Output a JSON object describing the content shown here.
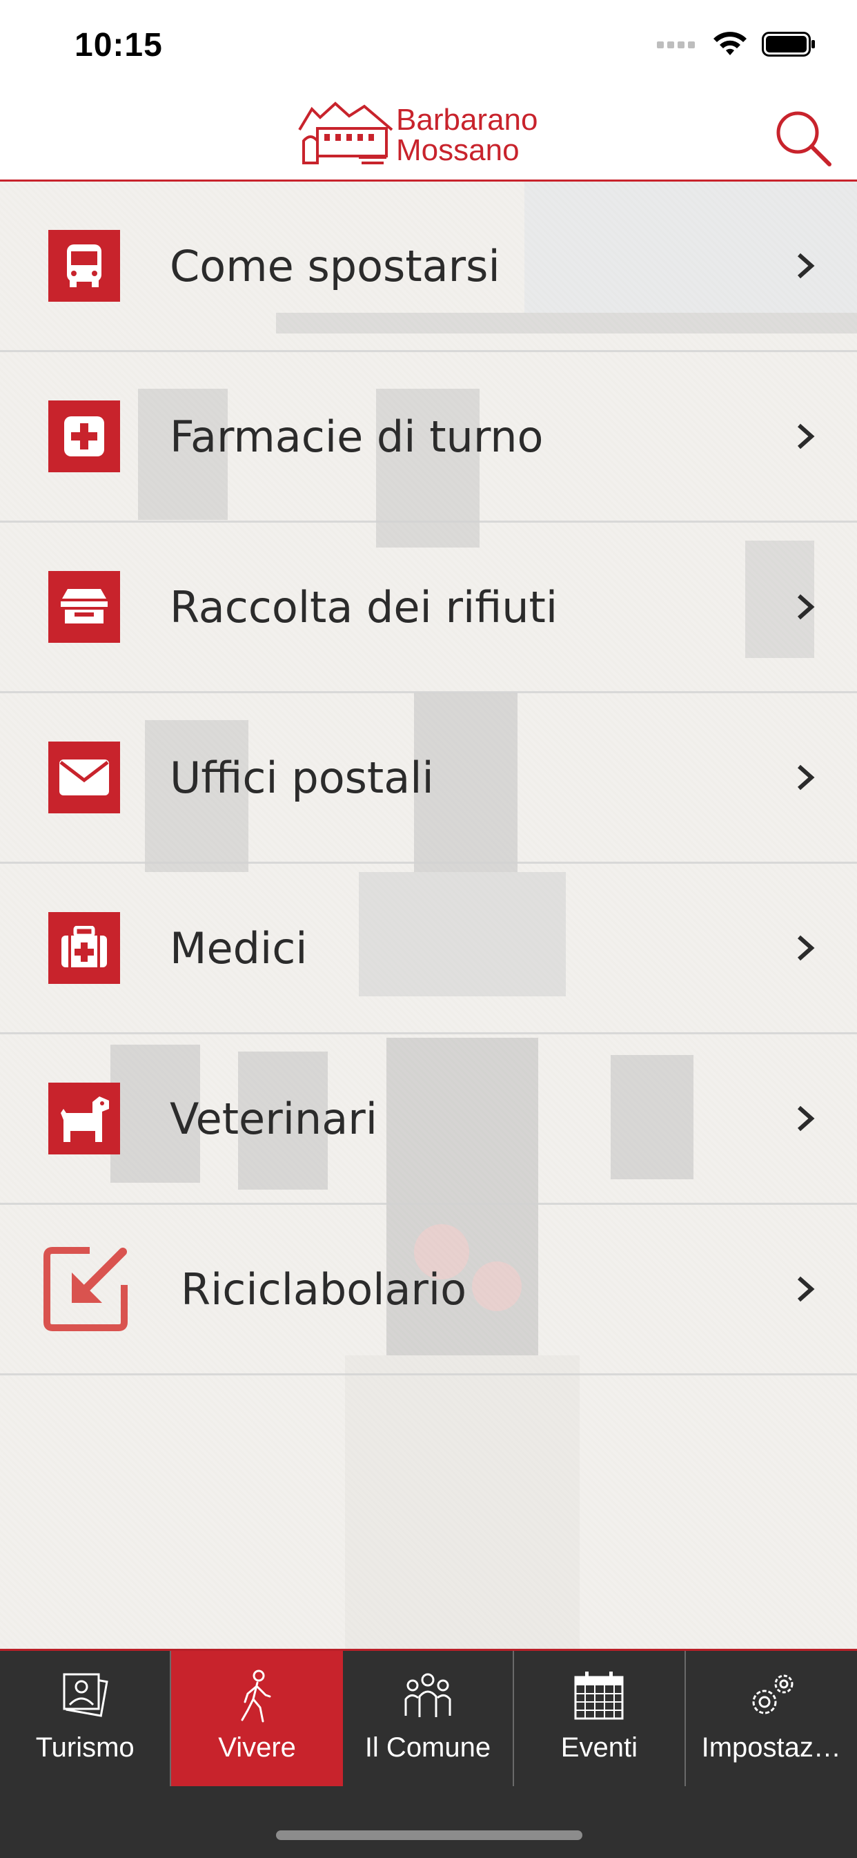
{
  "status_bar": {
    "time": "10:15"
  },
  "header": {
    "logo_line1": "Barbarano",
    "logo_line2": "Mossano",
    "search_icon": "search-icon"
  },
  "colors": {
    "accent": "#c8232c",
    "tabbar": "#303030",
    "text": "#2b2b2b"
  },
  "menu": {
    "items": [
      {
        "label": "Come spostarsi",
        "icon": "bus-icon"
      },
      {
        "label": "Farmacie di turno",
        "icon": "pharmacy-cross-icon"
      },
      {
        "label": "Raccolta dei rifiuti",
        "icon": "waste-bin-icon"
      },
      {
        "label": "Uffici postali",
        "icon": "envelope-icon"
      },
      {
        "label": "Medici",
        "icon": "medical-kit-icon"
      },
      {
        "label": "Veterinari",
        "icon": "dog-icon"
      },
      {
        "label": "Riciclabolario",
        "icon": "external-link-arrow-icon"
      }
    ]
  },
  "tabbar": {
    "tabs": [
      {
        "label": "Turismo",
        "icon": "photos-icon",
        "active": false
      },
      {
        "label": "Vivere",
        "icon": "walking-person-icon",
        "active": true
      },
      {
        "label": "Il Comune",
        "icon": "people-group-icon",
        "active": false
      },
      {
        "label": "Eventi",
        "icon": "calendar-icon",
        "active": false
      },
      {
        "label": "Impostaz…",
        "icon": "gears-icon",
        "active": false
      }
    ]
  }
}
